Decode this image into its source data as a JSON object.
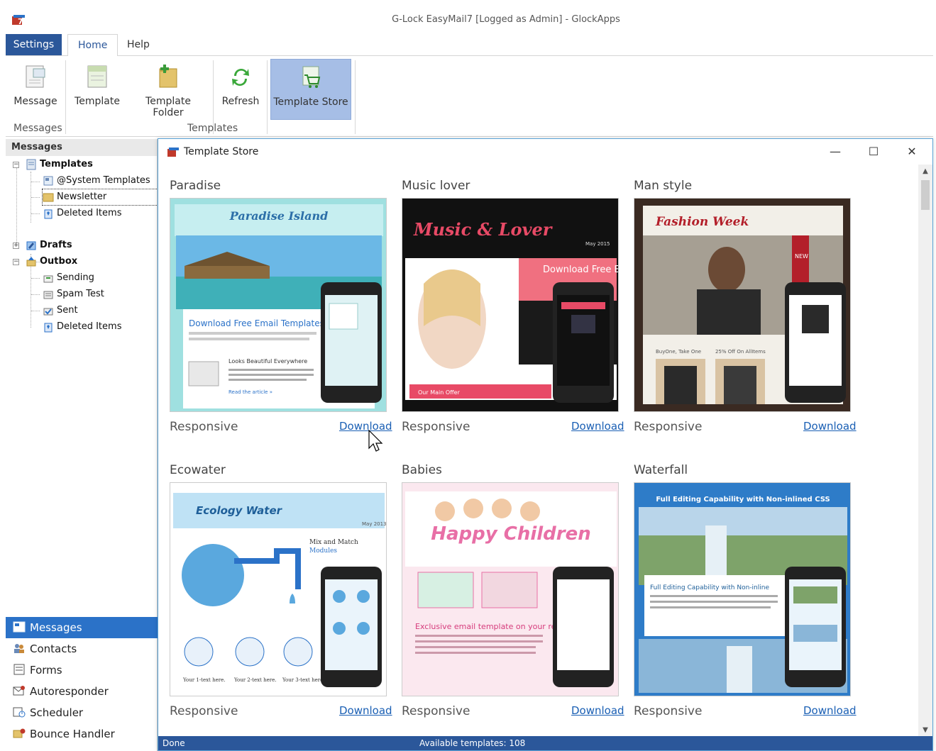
{
  "window": {
    "title": "G-Lock EasyMail7 [Logged as Admin] - GlockApps"
  },
  "ribbon": {
    "tabs": [
      "Settings",
      "Home",
      "Help"
    ],
    "buttons": {
      "message": "Message",
      "template": "Template",
      "template_folder": "Template Folder",
      "refresh": "Refresh",
      "template_store": "Template Store"
    },
    "groups": {
      "messages": "Messages",
      "templates": "Templates"
    }
  },
  "left_panel": {
    "header": "Messages",
    "tree": {
      "templates": "Templates",
      "system_templates": "@System Templates",
      "newsletter": "Newsletter",
      "deleted_items_1": "Deleted Items",
      "drafts": "Drafts",
      "outbox": "Outbox",
      "sending": "Sending",
      "spam_test": "Spam Test",
      "sent": "Sent",
      "deleted_items_2": "Deleted Items"
    },
    "nav": [
      "Messages",
      "Contacts",
      "Forms",
      "Autoresponder",
      "Scheduler",
      "Bounce Handler"
    ]
  },
  "dialog": {
    "title": "Template Store",
    "controls": {
      "minimize": "—",
      "maximize": "☐",
      "close": "✕"
    },
    "templates": [
      {
        "name": "Paradise",
        "type": "Responsive",
        "action": "Download",
        "preview": {
          "header": "Paradise Island",
          "headline": "Download Free Email Templates",
          "sub": "Looks Beautiful Everywhere",
          "link": "Read the article »"
        }
      },
      {
        "name": "Music lover",
        "type": "Responsive",
        "action": "Download",
        "preview": {
          "header": "Music & Lover",
          "headline": "Download Free Email Templates",
          "sub": "Our Main Offer",
          "date": "May 2015"
        }
      },
      {
        "name": "Man style",
        "type": "Responsive",
        "action": "Download",
        "preview": {
          "header": "Fashion Week",
          "sub": "BuyOne, Take One",
          "sub2": "25% Off On AllItems",
          "badge": "NEW"
        }
      },
      {
        "name": "Ecowater",
        "type": "Responsive",
        "action": "Download",
        "preview": {
          "header": "Ecology Water",
          "headline": "Mix and Match",
          "sub": "Modules",
          "date": "May 2013",
          "cap1": "Your 1-text here.",
          "cap2": "Your 2-text here.",
          "cap3": "Your 3-text here."
        }
      },
      {
        "name": "Babies",
        "type": "Responsive",
        "action": "Download",
        "preview": {
          "header": "Happy Children",
          "headline": "Exclusive email template on your re"
        }
      },
      {
        "name": "Waterfall",
        "type": "Responsive",
        "action": "Download",
        "preview": {
          "header": "Full Editing Capability with Non-inlined CSS",
          "headline": "Full Editing Capability with Non-inline"
        }
      }
    ],
    "status": {
      "left": "Done",
      "right": "Available templates: 108"
    }
  },
  "colors": {
    "accent": "#2b579a",
    "link": "#1a5fb4",
    "selected_nav": "#2b72c8"
  }
}
